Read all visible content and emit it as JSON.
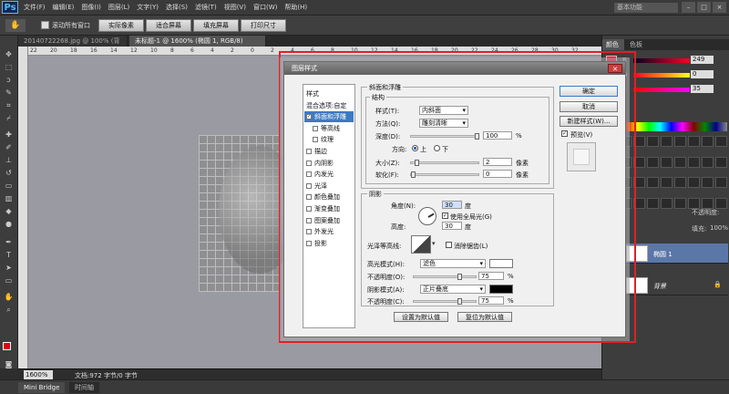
{
  "app": {
    "logo": "Ps",
    "menu": [
      "文件(F)",
      "编辑(E)",
      "图像(I)",
      "图层(L)",
      "文字(Y)",
      "选择(S)",
      "滤镜(T)",
      "视图(V)",
      "窗口(W)",
      "帮助(H)"
    ],
    "workspace": "基本功能"
  },
  "options": {
    "scroll_all": "滚动所有窗口",
    "b1": "实际像素",
    "b2": "适合屏幕",
    "b3": "填充屏幕",
    "b4": "打印尺寸"
  },
  "tabs": [
    "20140722268.jpg @ 100% (背景, RGB/8)",
    "未标题-1 @ 1600% (椭圆 1, RGB/8)"
  ],
  "ruler": {
    "ticks": [
      "22",
      "20",
      "18",
      "16",
      "14",
      "12",
      "10",
      "8",
      "6",
      "4",
      "2",
      "0",
      "2",
      "4",
      "6",
      "8",
      "10",
      "12",
      "14",
      "16",
      "18",
      "20",
      "22",
      "24",
      "26",
      "28",
      "30",
      "32"
    ]
  },
  "status": {
    "zoom": "1600%",
    "doc": "文档:972 字节/0 字节"
  },
  "bottom": [
    "Mini Bridge",
    "时间轴"
  ],
  "panel": {
    "tabs": [
      "颜色",
      "色板"
    ],
    "channels": [
      {
        "label": "R",
        "value": "249"
      },
      {
        "label": "G",
        "value": "0"
      },
      {
        "label": "B",
        "value": "35"
      }
    ],
    "fill_label": "填充:",
    "fill_value": "100%",
    "opacity_label": "不透明度:",
    "layers": [
      {
        "name": "椭圆 1"
      },
      {
        "name": "背景"
      }
    ]
  },
  "dialog": {
    "title": "图层样式",
    "list": [
      {
        "label": "样式",
        "type": "hdr"
      },
      {
        "label": "混合选项:自定",
        "type": "hdr"
      },
      {
        "label": "斜面和浮雕",
        "type": "sel"
      },
      {
        "label": "等高线",
        "type": "sub"
      },
      {
        "label": "纹理",
        "type": "sub"
      },
      {
        "label": "描边",
        "type": "item"
      },
      {
        "label": "内阴影",
        "type": "item"
      },
      {
        "label": "内发光",
        "type": "item"
      },
      {
        "label": "光泽",
        "type": "item"
      },
      {
        "label": "颜色叠加",
        "type": "item"
      },
      {
        "label": "渐变叠加",
        "type": "item"
      },
      {
        "label": "图案叠加",
        "type": "item"
      },
      {
        "label": "外发光",
        "type": "item"
      },
      {
        "label": "投影",
        "type": "item"
      }
    ],
    "bevel": {
      "section": "斜面和浮雕",
      "structure": "结构",
      "style_label": "样式(T):",
      "style_value": "内斜面",
      "technique_label": "方法(Q):",
      "technique_value": "雕刻清晰",
      "depth_label": "深度(D):",
      "depth_value": "100",
      "depth_unit": "%",
      "depth_level": 1.0,
      "direction_label": "方向:",
      "dir_up": "上",
      "dir_down": "下",
      "size_label": "大小(Z):",
      "size_value": "2",
      "size_unit": "像素",
      "size_level": 0.05,
      "soften_label": "软化(F):",
      "soften_value": "0",
      "soften_unit": "像素",
      "soften_level": 0.0
    },
    "shading": {
      "section": "阴影",
      "angle_label": "角度(N):",
      "angle_value": "30",
      "angle_unit": "度",
      "global_light": "使用全局光(G)",
      "altitude_label": "高度:",
      "altitude_value": "30",
      "altitude_unit": "度",
      "gloss_label": "光泽等高线:",
      "antialias": "消除锯齿(L)",
      "hl_mode_label": "高光模式(H):",
      "hl_mode_value": "滤色",
      "hl_color": "#ffffff",
      "hl_opacity_label": "不透明度(O):",
      "hl_opacity_value": "75",
      "hl_opacity_unit": "%",
      "hl_level": 0.75,
      "sh_mode_label": "阴影模式(A):",
      "sh_mode_value": "正片叠底",
      "sh_color": "#000000",
      "sh_opacity_label": "不透明度(C):",
      "sh_opacity_value": "75",
      "sh_opacity_unit": "%",
      "sh_level": 0.75
    },
    "btn_default": "设置为默认值",
    "btn_reset": "复位为默认值",
    "ok": "确定",
    "cancel": "取消",
    "new_style": "新建样式(W)...",
    "preview": "预览(V)"
  }
}
